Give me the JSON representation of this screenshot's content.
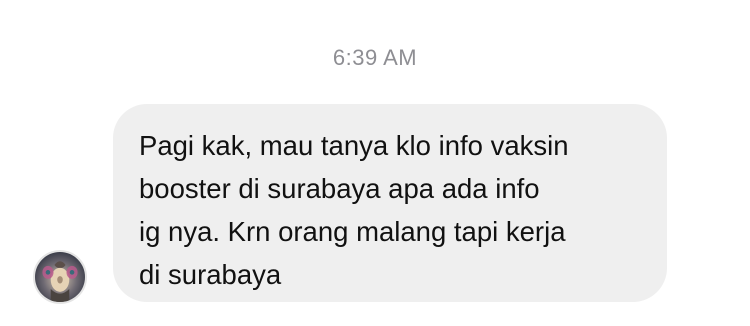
{
  "thread": {
    "timestamp": "6:39 AM",
    "messages": [
      {
        "direction": "incoming",
        "text": "Pagi kak, mau tanya klo info vaksin\nbooster di surabaya apa ada info\nig nya. Krn orang malang tapi kerja\ndi surabaya",
        "avatar_icon": "contact-avatar-photo"
      }
    ]
  },
  "colors": {
    "bubble_background": "#efefef",
    "timestamp_text": "#8e8e93",
    "message_text": "#111111"
  }
}
